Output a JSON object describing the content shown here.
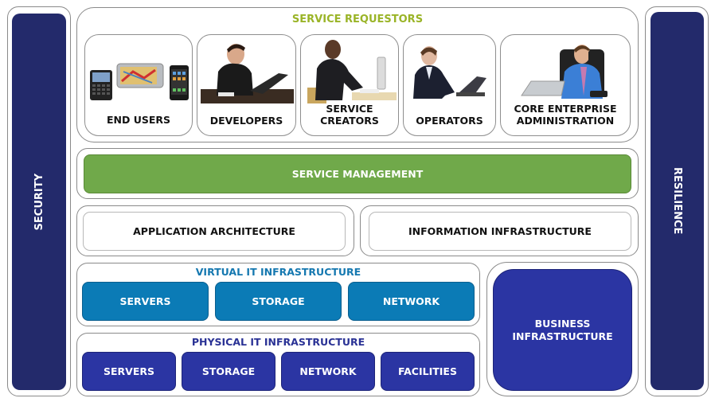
{
  "pillars": {
    "left": {
      "label": "SECURITY",
      "color": "#232a6b"
    },
    "right": {
      "label": "RESILIENCE",
      "color": "#232a6b"
    }
  },
  "service_requestors": {
    "title": "SERVICE REQUESTORS",
    "title_color": "#9ab427",
    "cards": [
      {
        "label": "END USERS",
        "image": "mobile-devices"
      },
      {
        "label": "DEVELOPERS",
        "image": "developer-at-laptop"
      },
      {
        "label_line1": "SERVICE",
        "label_line2": "CREATORS",
        "image": "businessman-at-computer"
      },
      {
        "label": "OPERATORS",
        "image": "woman-at-laptop"
      },
      {
        "label_line1": "CORE ENTERPRISE",
        "label_line2": "ADMINISTRATION",
        "image": "man-on-phone-at-desk"
      }
    ]
  },
  "service_management": {
    "label": "SERVICE MANAGEMENT",
    "color": "#70a94a"
  },
  "architecture": {
    "application": "APPLICATION ARCHITECTURE",
    "information": "INFORMATION INFRASTRUCTURE"
  },
  "virtual_it": {
    "title": "VIRTUAL IT INFRASTRUCTURE",
    "color": "#0b7bb6",
    "items": [
      "SERVERS",
      "STORAGE",
      "NETWORK"
    ]
  },
  "physical_it": {
    "title": "PHYSICAL IT INFRASTRUCTURE",
    "color": "#2b35a3",
    "items": [
      "SERVERS",
      "STORAGE",
      "NETWORK",
      "FACILITIES"
    ]
  },
  "business_infrastructure": {
    "line1": "BUSINESS",
    "line2": "INFRASTRUCTURE",
    "color": "#2b35a3"
  }
}
